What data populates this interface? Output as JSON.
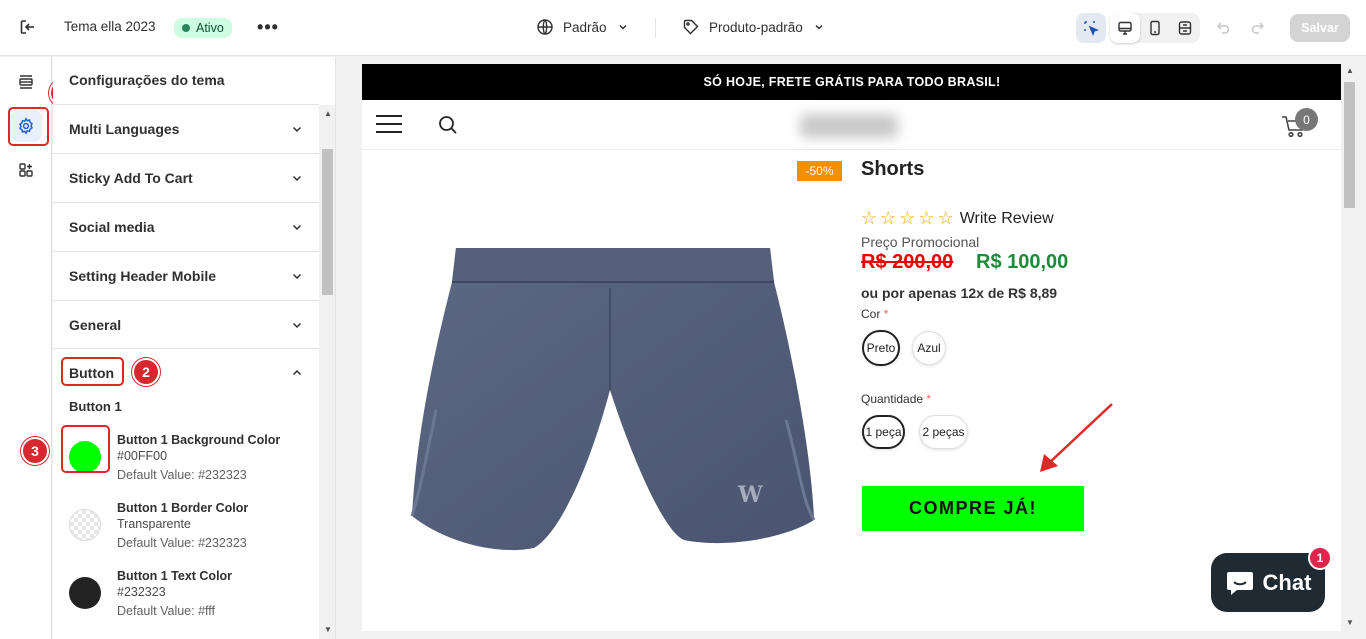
{
  "topbar": {
    "theme_name": "Tema ella 2023",
    "status_badge": "Ativo",
    "language": "Padrão",
    "template": "Produto-padrão",
    "save_label": "Salvar"
  },
  "panel": {
    "title": "Configurações do tema",
    "sections": [
      {
        "label": "Multi Languages"
      },
      {
        "label": "Sticky Add To Cart"
      },
      {
        "label": "Social media"
      },
      {
        "label": "Setting Header Mobile"
      },
      {
        "label": "General"
      },
      {
        "label": "Button"
      }
    ],
    "subsection": "Button 1",
    "settings": [
      {
        "name": "Button 1 Background Color",
        "value": "#00FF00",
        "default": "Default Value: #232323",
        "swatch": "#00ff00"
      },
      {
        "name": "Button 1 Border Color",
        "value": "Transparente",
        "default": "Default Value: #232323",
        "swatch": "transparent"
      },
      {
        "name": "Button 1 Text Color",
        "value": "#232323",
        "default": "Default Value: #fff",
        "swatch": "#232323"
      }
    ]
  },
  "annotations": {
    "one": "1",
    "two": "2",
    "three": "3"
  },
  "preview": {
    "announcement": "SÓ HOJE, FRETE GRÁTIS PARA TODO BRASIL!",
    "cart_count": "0",
    "discount_badge": "-50%",
    "product_title": "Shorts",
    "rating_stars": 0,
    "review_link": "Write Review",
    "promo_label": "Preço Promocional",
    "price_old": "R$ 200,00",
    "price_new": "R$ 100,00",
    "installments": "ou por apenas 12x de R$ 8,89",
    "color_label": "Cor",
    "color_options": [
      "Preto",
      "Azul"
    ],
    "quantity_label": "Quantidade",
    "quantity_options": [
      "1 peça",
      "2 peças"
    ],
    "required_mark": "*",
    "buy_button": "COMPRE JÁ!",
    "chat_label": "Chat",
    "chat_badge": "1"
  },
  "colors": {
    "accent_green": "#00ff00",
    "annotation_red": "#d7282f",
    "announcement_bg": "#000000",
    "discount_bg": "#f29000",
    "price_old": "#ee0000",
    "price_new": "#1e8a3a",
    "chat_bg": "#1f2a33"
  }
}
